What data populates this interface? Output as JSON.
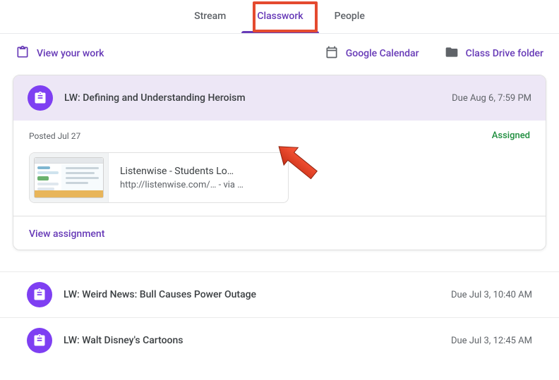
{
  "tabs": {
    "stream": {
      "label": "Stream"
    },
    "classwork": {
      "label": "Classwork"
    },
    "people": {
      "label": "People"
    }
  },
  "actions": {
    "view_work": "View your work",
    "calendar": "Google Calendar",
    "drive": "Class Drive folder"
  },
  "expanded": {
    "title": "LW: Defining and Understanding Heroism",
    "due": "Due Aug 6, 7:59 PM",
    "posted": "Posted Jul 27",
    "status": "Assigned",
    "attachment": {
      "title": "Listenwise - Students Lo…",
      "sub": "http://listenwise.com/…  - via …"
    },
    "view_link": "View assignment"
  },
  "rows": [
    {
      "title": "LW: Weird News: Bull Causes Power Outage",
      "due": "Due Jul 3, 10:40 AM"
    },
    {
      "title": "LW: Walt Disney's Cartoons",
      "due": "Due Jul 3, 12:45 AM"
    }
  ]
}
